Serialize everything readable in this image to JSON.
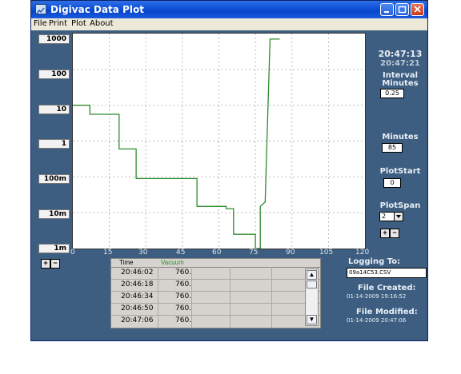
{
  "window": {
    "title": "Digivac Data Plot"
  },
  "menu": [
    "File",
    "Print",
    "Plot",
    "About"
  ],
  "y_labels": [
    "1000",
    "100",
    "10",
    "1",
    "100m",
    "10m",
    "1m"
  ],
  "x_labels": [
    "0",
    "15",
    "30",
    "45",
    "60",
    "75",
    "90",
    "105",
    "120"
  ],
  "times": {
    "current": "20:47:13",
    "last": "20:47:21"
  },
  "interval": {
    "label_line1": "Interval",
    "label_line2": "Minutes",
    "value": "0.25"
  },
  "minutes": {
    "label": "Minutes",
    "value": "85"
  },
  "plot_start": {
    "label": "PlotStart",
    "value": "0"
  },
  "plot_span": {
    "label": "PlotSpan",
    "value": "2"
  },
  "zoom": {
    "plus": "+",
    "minus": "−"
  },
  "table": {
    "headers": [
      "Time",
      "Vacuum"
    ],
    "rows": [
      [
        "20:46:02",
        "760."
      ],
      [
        "20:46:18",
        "760."
      ],
      [
        "20:46:34",
        "760."
      ],
      [
        "20:46:50",
        "760."
      ],
      [
        "20:47:06",
        "760."
      ]
    ]
  },
  "logging": {
    "label": "Logging To:",
    "file": "09a14C53.CSV"
  },
  "created": {
    "label": "File Created:",
    "value": "01-14-2009  19:16:52"
  },
  "modified": {
    "label": "File Modified:",
    "value": "01-14-2009  20:47:06"
  },
  "chart_data": {
    "type": "line",
    "xlim": [
      0,
      120
    ],
    "ylim": [
      "1m",
      "1000"
    ],
    "y_log_decades": [
      -3,
      3
    ],
    "series": [
      {
        "color": "#2e8b2e",
        "points": [
          [
            0,
            10
          ],
          [
            7,
            10
          ],
          [
            7,
            5.6
          ],
          [
            19,
            5.6
          ],
          [
            19,
            0.6
          ],
          [
            26,
            0.6
          ],
          [
            26,
            0.09
          ],
          [
            51,
            0.09
          ],
          [
            51,
            0.015
          ],
          [
            63,
            0.015
          ],
          [
            63,
            0.013
          ],
          [
            66,
            0.013
          ],
          [
            66,
            0.0025
          ],
          [
            75,
            0.0025
          ],
          [
            75,
            0.001
          ],
          [
            77,
            0.001
          ],
          [
            77,
            0.015
          ],
          [
            79,
            0.02
          ],
          [
            81,
            700
          ],
          [
            85,
            700
          ]
        ]
      }
    ]
  },
  "colors": {
    "background": "#3d5e80",
    "line": "#2e8b2e"
  }
}
